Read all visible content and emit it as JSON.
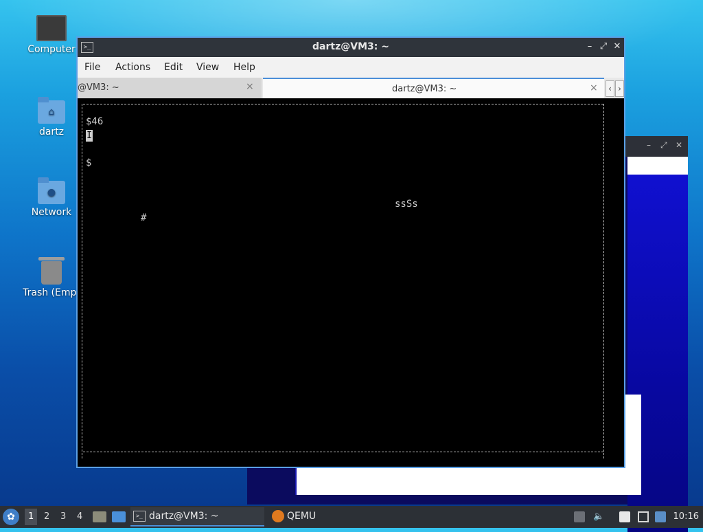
{
  "desktop": {
    "icons": [
      {
        "label": "Computer"
      },
      {
        "label": "dartz"
      },
      {
        "label": "Network"
      },
      {
        "label": "Trash (Empt"
      }
    ]
  },
  "terminal": {
    "title": "dartz@VM3: ~",
    "menu": [
      "File",
      "Actions",
      "Edit",
      "View",
      "Help"
    ],
    "tabs": [
      {
        "label": "@VM3: ~",
        "active": false
      },
      {
        "label": "dartz@VM3: ~",
        "active": true
      }
    ],
    "close_glyph": "×",
    "screen": {
      "status": "$46",
      "cursor": "I",
      "dollar": "$",
      "hash": "#",
      "snake": "ssSs"
    }
  },
  "taskbar": {
    "workspaces": [
      "1",
      "2",
      "3",
      "4"
    ],
    "tasks": [
      {
        "label": "dartz@VM3: ~",
        "active": true
      },
      {
        "label": "QEMU",
        "active": false
      }
    ],
    "clock": "10:16"
  },
  "colors": {
    "accent": "#4b8ed8",
    "terminal_bg": "#000000",
    "titlebar": "#2f343b"
  }
}
